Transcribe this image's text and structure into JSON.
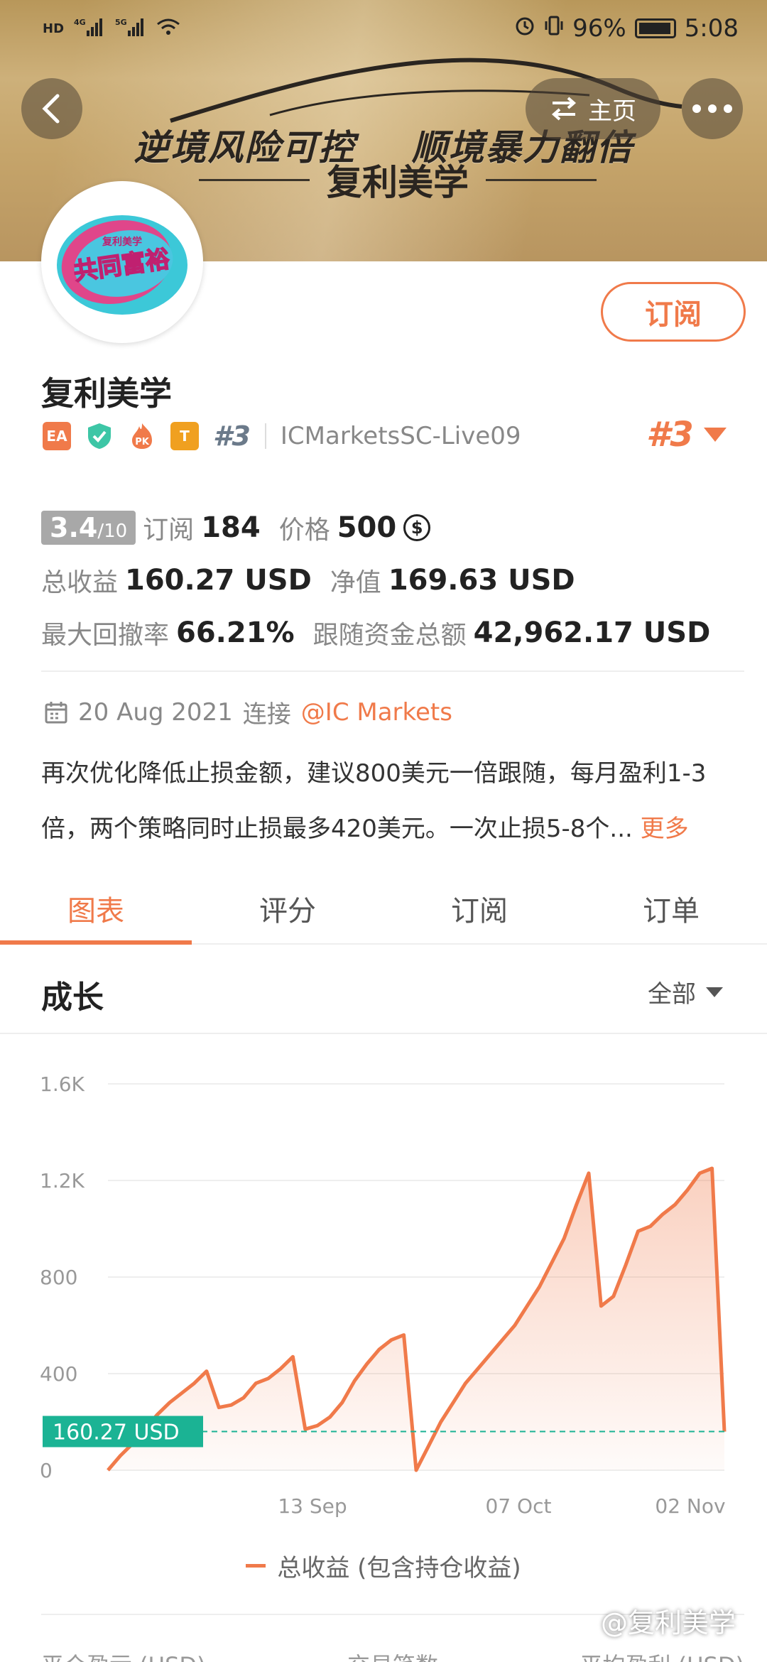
{
  "status_bar": {
    "battery": "96%",
    "time": "5:08",
    "net_left": "HD",
    "sig1": "4G",
    "sig2": "5G"
  },
  "banner": {
    "slogan": "逆境风险可控 顺境暴力翻倍",
    "subtitle": "复利美学",
    "home_label": "主页"
  },
  "avatar": {
    "line1": "复利美学",
    "line2": "共同富裕"
  },
  "profile": {
    "name": "复利美学",
    "subscribe_label": "订阅",
    "badges": [
      "EA",
      "PK",
      "T"
    ],
    "rank_small": "#3",
    "account": "ICMarketsSC-Live09",
    "rank_big": "#3"
  },
  "stats": {
    "score": "3.4",
    "score_max": "/10",
    "subs_label": "订阅",
    "subs_value": "184",
    "price_label": "价格",
    "price_value": "500",
    "total_label": "总收益",
    "total_value": "160.27 USD",
    "equity_label": "净值",
    "equity_value": "169.63 USD",
    "drawdown_label": "最大回撤率",
    "drawdown_value": "66.21%",
    "follow_label": "跟随资金总额",
    "follow_value": "42,962.17 USD"
  },
  "since": {
    "date": "20 Aug 2021",
    "connect": "连接",
    "broker": "@IC Markets"
  },
  "description": {
    "text": "再次优化降低止损金额，建议800美元一倍跟随，每月盈利1-3倍，两个策略同时止损最多420美元。一次止损5-8个...",
    "more": "更多"
  },
  "tabs": [
    "图表",
    "评分",
    "订阅",
    "订单"
  ],
  "section": {
    "title": "成长",
    "range": "全部"
  },
  "chart_data": {
    "type": "area",
    "y_ticks": [
      "1.6K",
      "1.2K",
      "800",
      "400",
      "0"
    ],
    "ylim": [
      0,
      1600
    ],
    "x_ticks": [
      "13 Sep",
      "07 Oct",
      "02 Nov"
    ],
    "current_label": "160.27 USD",
    "current_value": 160.27,
    "series": [
      {
        "name": "总收益 (包含持仓收益)",
        "values": [
          0,
          60,
          110,
          170,
          230,
          280,
          320,
          360,
          410,
          260,
          270,
          300,
          360,
          380,
          420,
          470,
          170,
          185,
          220,
          280,
          370,
          440,
          500,
          540,
          560,
          0,
          100,
          200,
          280,
          360,
          420,
          480,
          540,
          600,
          680,
          760,
          860,
          960,
          1100,
          1230,
          680,
          720,
          850,
          990,
          1010,
          1060,
          1100,
          1160,
          1230,
          1250,
          160
        ]
      }
    ]
  },
  "legend": {
    "label": "总收益 (包含持仓收益)"
  },
  "bottom_labels": [
    "平仓盈亏 (USD)",
    "交易笔数",
    "平均盈利 (USD)"
  ],
  "watermark": "@复利美学",
  "colors": {
    "accent": "#f07a4a",
    "teal": "#1bb394"
  }
}
